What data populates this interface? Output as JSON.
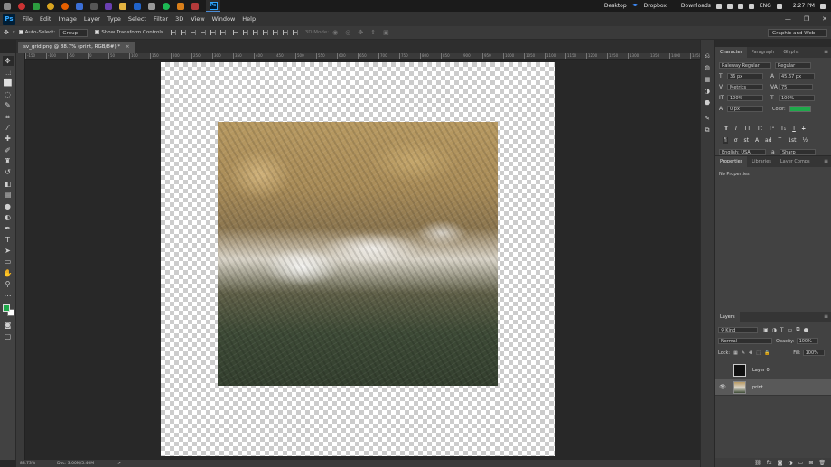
{
  "taskbar": {
    "tray": {
      "desktop": "Desktop",
      "dropbox": "Dropbox",
      "downloads": "Downloads",
      "lang": "ENG",
      "time": "2:27 PM"
    }
  },
  "menubar": {
    "logo": "Ps",
    "items": [
      "File",
      "Edit",
      "Image",
      "Layer",
      "Type",
      "Select",
      "Filter",
      "3D",
      "View",
      "Window",
      "Help"
    ]
  },
  "options": {
    "auto_select": "Auto-Select:",
    "group": "Group",
    "show_transform": "Show Transform Controls",
    "mode_3d": "3D Mode:",
    "workspace": "Graphic and Web"
  },
  "document": {
    "tab_label": "sv_grid.png @ 88.7% (print, RGB/8#) *",
    "close": "×"
  },
  "ruler": {
    "ticks": [
      "-150",
      "-100",
      "-50",
      "0",
      "50",
      "100",
      "150",
      "200",
      "250",
      "300",
      "350",
      "400",
      "450",
      "500",
      "550",
      "600",
      "650",
      "700",
      "750",
      "800",
      "850",
      "900",
      "950",
      "1000",
      "1050",
      "1100",
      "1150",
      "1200",
      "1250",
      "1300",
      "1350",
      "1400",
      "1450"
    ]
  },
  "status": {
    "zoom": "88.73%",
    "doc": "Doc: 3.00M/5.40M",
    "arrow": ">"
  },
  "character": {
    "tabs": [
      "Character",
      "Paragraph",
      "Glyphs"
    ],
    "font_family": "Raleway Regular",
    "font_style": "Regular",
    "font_size": "36 px",
    "leading": "45.67 px",
    "kerning": "Metrics",
    "tracking": "75",
    "vscale": "100%",
    "hscale": "100%",
    "baseline": "0 px",
    "color_label": "Color:",
    "color": "#1ea84a",
    "language": "English: USA",
    "antialias": "Sharp",
    "type_styles": [
      "T",
      "T",
      "TT",
      "Tt",
      "T¹",
      "T₁",
      "T",
      "T"
    ],
    "feature_styles": [
      "fi",
      "ơ",
      "st",
      "A",
      "ad",
      "T",
      "1st",
      "½"
    ]
  },
  "properties": {
    "tabs": [
      "Properties",
      "Libraries",
      "Layer Comps"
    ],
    "empty": "No Properties"
  },
  "layers": {
    "tab": "Layers",
    "filter": "Kind",
    "blend": "Normal",
    "opacity_label": "Opacity:",
    "opacity": "100%",
    "lock_label": "Lock:",
    "fill_label": "Fill:",
    "fill": "100%",
    "items": [
      {
        "name": "Layer 0",
        "visible": false
      },
      {
        "name": "print",
        "visible": true
      }
    ]
  }
}
